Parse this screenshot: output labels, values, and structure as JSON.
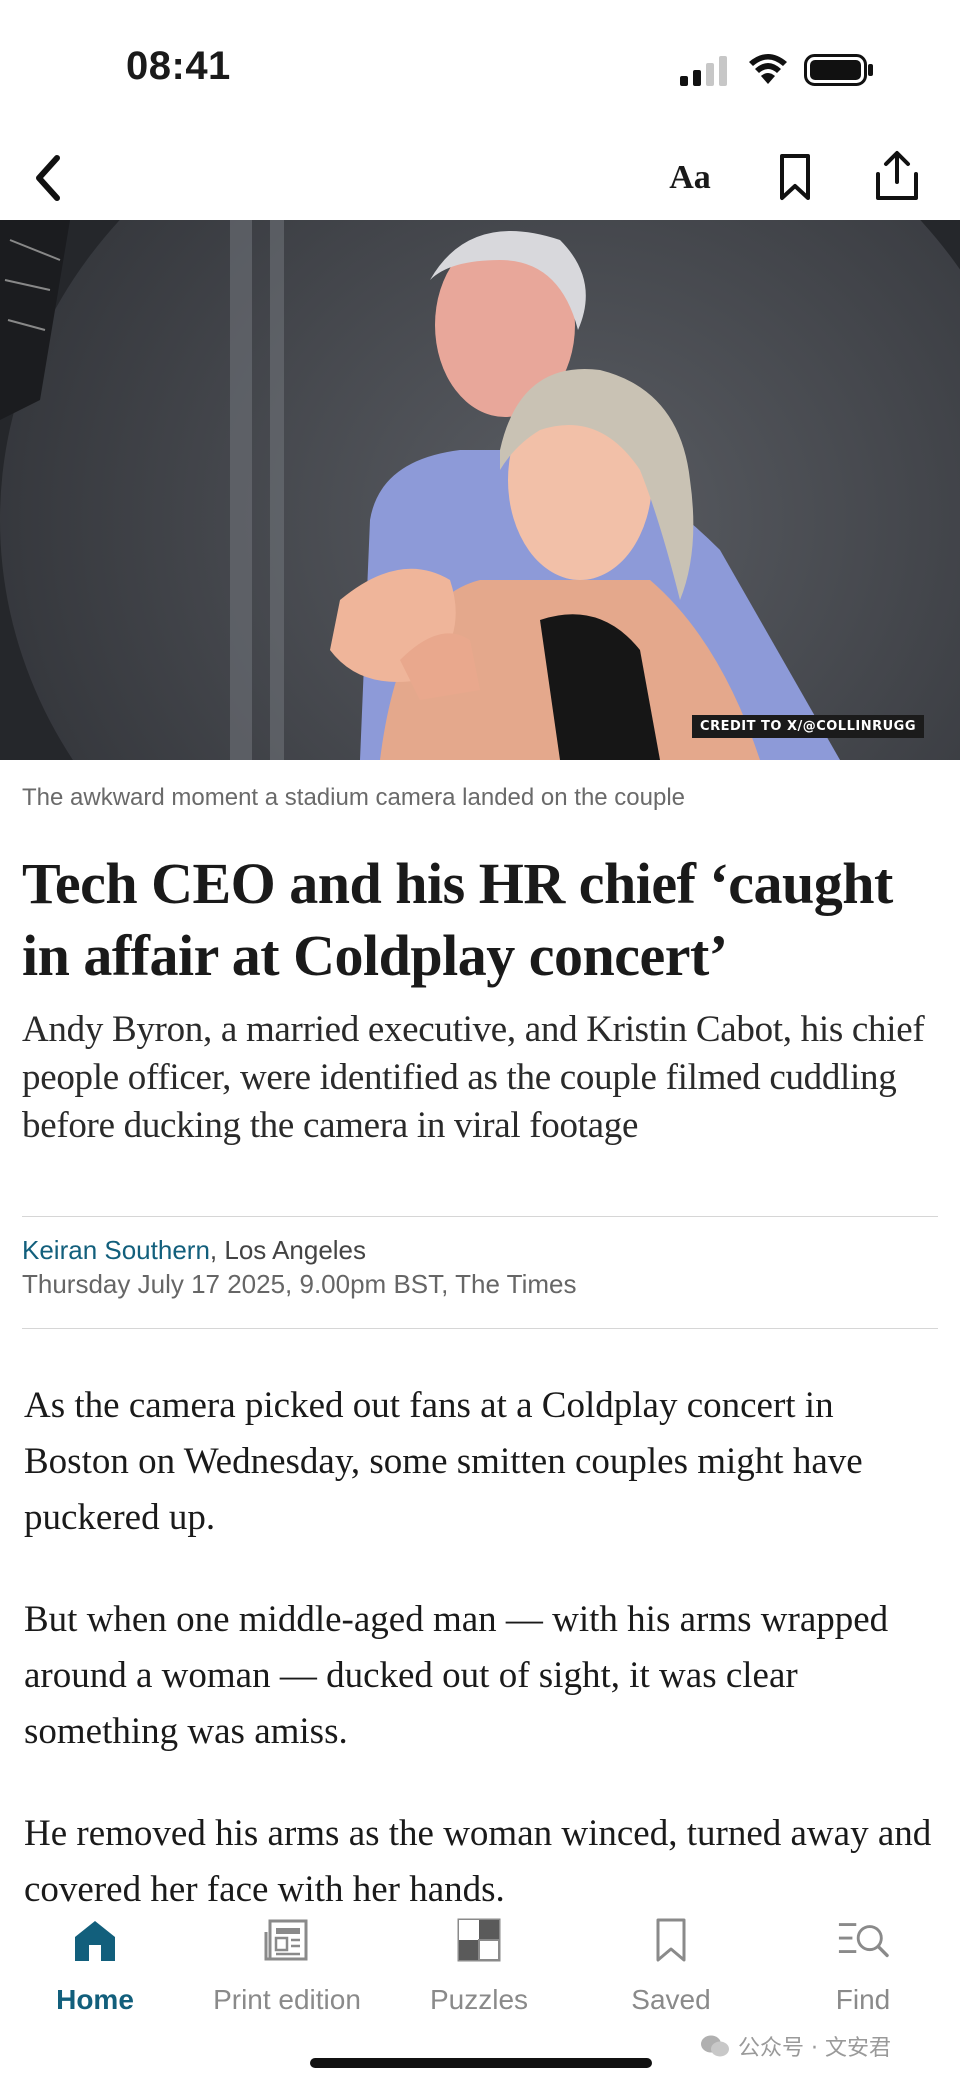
{
  "status_bar": {
    "time": "08:41"
  },
  "nav": {
    "text_size_label": "Aa"
  },
  "hero": {
    "credit": "CREDIT TO X/@COLLINRUGG"
  },
  "article": {
    "caption": "The awkward moment a stadium camera landed on the couple",
    "headline": "Tech CEO and his HR chief ‘caught in affair at Coldplay concert’",
    "standfirst": "Andy Byron, a married executive, and Kristin Cabot, his chief people officer, were identified as the couple filmed cuddling before ducking the camera in viral footage",
    "author": "Keiran Southern",
    "location": ", Los Angeles",
    "dateline": "Thursday July 17 2025, 9.00pm BST, The Times",
    "paragraphs": [
      "As the camera picked out fans at a Coldplay concert in Boston on Wednesday, some smitten couples might have puckered up.",
      "But when one middle-aged man — with his arms wrapped around a woman — ducked out of sight, it was clear something was amiss.",
      "He removed his arms as the woman winced, turned away and covered her face with her hands."
    ]
  },
  "tabs": [
    {
      "label": "Home",
      "icon": "home-icon",
      "active": true
    },
    {
      "label": "Print edition",
      "icon": "newspaper-icon",
      "active": false
    },
    {
      "label": "Puzzles",
      "icon": "puzzle-grid-icon",
      "active": false
    },
    {
      "label": "Saved",
      "icon": "bookmark-icon",
      "active": false
    },
    {
      "label": "Find",
      "icon": "search-list-icon",
      "active": false
    }
  ],
  "watermark": {
    "text": "公众号 · 文安君"
  },
  "colors": {
    "accent": "#125f7c",
    "text": "#1a1a1a",
    "muted": "#8a8a8a"
  }
}
